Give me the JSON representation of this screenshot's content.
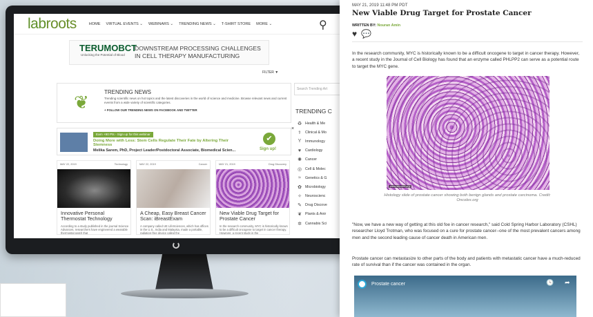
{
  "site": {
    "logo_lab": "lab",
    "logo_roots": "roots",
    "nav": [
      "HOME",
      "VIRTUAL EVENTS ⌄",
      "WEBINARS ⌄",
      "TRENDING NEWS ⌄",
      "T-SHIRT STORE",
      "MORE ⌄"
    ],
    "ad": {
      "brand": "TERUMOBCT",
      "brand_sub": "Unlocking the Potential of Blood",
      "line1": "DOWNSTREAM PROCESSING CHALLENGES",
      "line2": "IN CELL THERAPY MANUFACTURING"
    },
    "filter_label": "FILTER ▼",
    "search_placeholder": "Search Trending Art",
    "trending": {
      "title": "TRENDING NEWS",
      "desc": "Trending scientific news on hot topics and the latest discoveries in the world of science and medicine. Browse relevant news and current events from a wide variety of scientific categories.",
      "follow": "+ FOLLOW OUR TRENDING NEWS ON FACEBOOK AND TWITTER"
    },
    "side_trending": "TRENDING C",
    "categories": [
      {
        "label": "Health & Me",
        "icon": "♻"
      },
      {
        "label": "Clinical & Mo",
        "icon": "⚕"
      },
      {
        "label": "Immunology",
        "icon": "Y"
      },
      {
        "label": "Cardiology",
        "icon": "♥"
      },
      {
        "label": "Cancer",
        "icon": "✺"
      },
      {
        "label": "Cell & Molec",
        "icon": "◎"
      },
      {
        "label": "Genetics & G",
        "icon": "≈"
      },
      {
        "label": "Microbiology",
        "icon": "✿"
      },
      {
        "label": "Neuroscienc",
        "icon": "✧"
      },
      {
        "label": "Drug Discove",
        "icon": "✎"
      },
      {
        "label": "Plants & Anir",
        "icon": "❦"
      },
      {
        "label": "Cannabis Sci",
        "icon": "✲"
      }
    ],
    "promo": {
      "points": "Earn +90 Pts - Sign up for this webinar",
      "title": "Doing More with Less: Stem Cells Regulate Their Fate by Altering Their Stemness",
      "author": "Melika Sarem, PhD, Project Leader/Postdoctoral Associate, Biomedical Scien...",
      "check": "✔",
      "signup": "Sign up!",
      "close": "×"
    },
    "cards": [
      {
        "date": "MAY 22, 2019",
        "tag": "Technology",
        "title": "Innovative Personal Thermostat Technology",
        "excerpt": "According to a study published in the journal Science Advances, researchers have engineered a wearable thermostat patch that"
      },
      {
        "date": "MAY 22, 2019",
        "tag": "Cancer",
        "title": "A Cheap, Easy Breast Cancer Scan: iBreastExam",
        "excerpt": "A company called UE LifeSciences, which has offices in the U.S., India and Malaysia, made a portable, radiation-free device called the"
      },
      {
        "date": "MAY 21, 2019",
        "tag": "Drug Discovery",
        "title": "New Viable Drug Target for Prostate Cancer",
        "excerpt": "In the research community, MYC is historically known to be a difficult oncogene to target in cancer therapy. However, a recent study in the"
      }
    ]
  },
  "article": {
    "date": "MAY 21, 2019 11:48 PM PDT",
    "title": "New Viable Drug Target for Prostate Cancer",
    "written_by": "WRITTEN BY:",
    "author": "Nouran Amin",
    "like_icon": "♥",
    "comment_icon": "💬",
    "p1": "In the research community, MYC is historically known to be a difficult oncogene to target in cancer therapy. However, a recent study in the Journal of Cell Biology has found that an enzyme called PHLPP2 can serve as a potential route to target the MYC gene.",
    "figure_tag": "www.oncolex.org",
    "caption": "Histology slide of prostate cancer showing both benign glands and prostate carcinoma. Credit: Oncolex.org",
    "p2": "\"Now, we have a new way of getting at this old foe in cancer research,\" said Cold Spring Harbor Laboratory (CSHL) researcher Lloyd Trotman, who was focused on a cure for prostate cancer--one of the most prevalent cancers among men and the second leading cause of cancer death in American men.",
    "p3": "Prostate cancer can metastasize to other parts of the body and patients with metastatic cancer have a much-reduced rate of survival than if the cancer was contained in the organ.",
    "video_title": "Prostate cancer",
    "video_clock_icon": "🕓",
    "video_share_icon": "➦"
  }
}
